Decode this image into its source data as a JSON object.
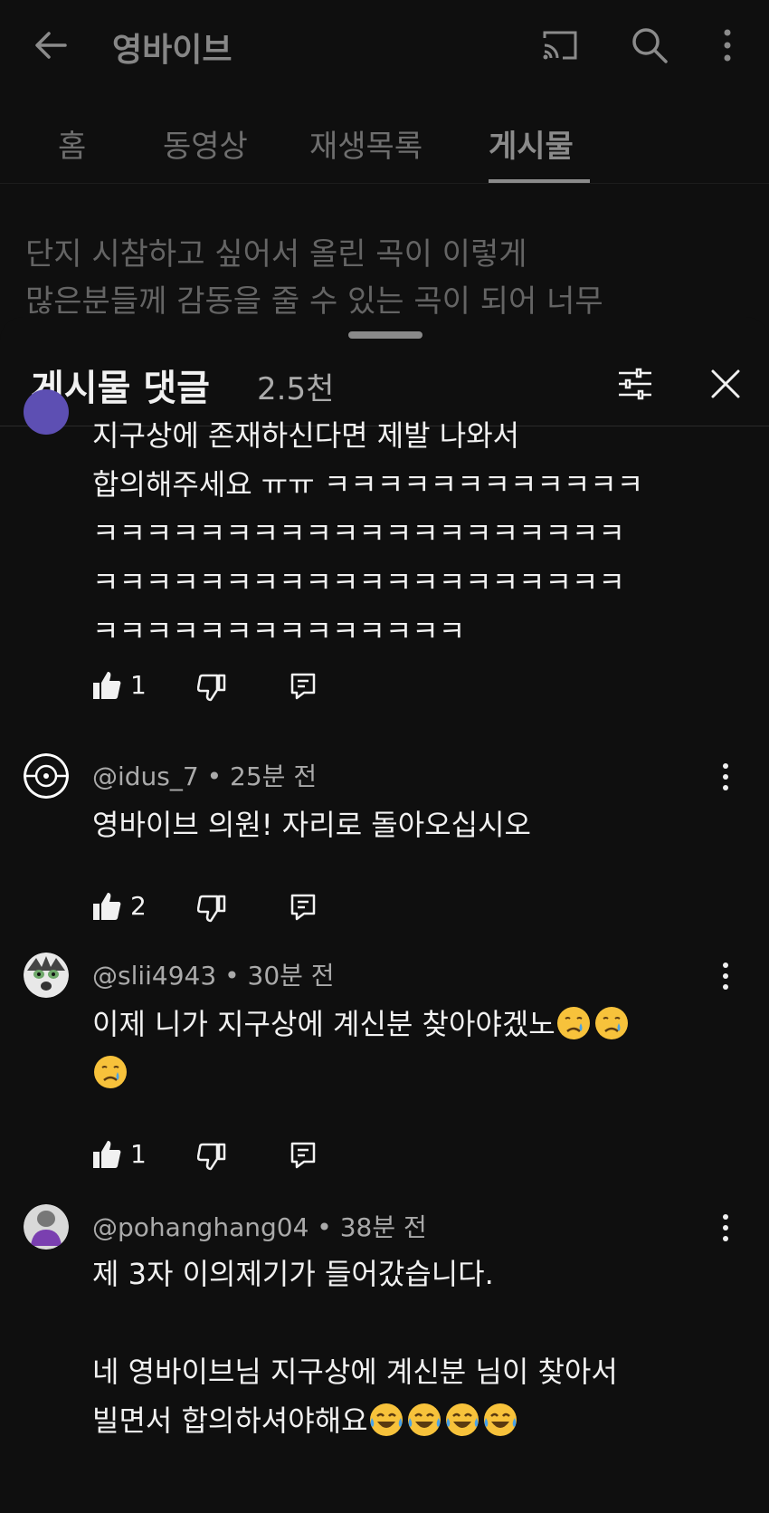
{
  "app": {
    "channel_title": "영바이브",
    "tabs": [
      {
        "label": "홈",
        "active": false
      },
      {
        "label": "동영상",
        "active": false
      },
      {
        "label": "재생목록",
        "active": false
      },
      {
        "label": "게시물",
        "active": true
      }
    ],
    "post_text_line1": "단지 시참하고 싶어서 올린 곡이 이렇게",
    "post_text_line2": "많은분들께 감동을 줄 수 있는 곡이 되어 너무"
  },
  "sheet": {
    "title": "게시물 댓글",
    "count": "2.5천"
  },
  "comments": [
    {
      "author": "",
      "time": "",
      "text": "지구상에 존재하신다면 제발 나와서\n합의해주세요 ㅠㅠ ㅋㅋㅋㅋㅋㅋㅋㅋㅋㅋㅋㅋ\nㅋㅋㅋㅋㅋㅋㅋㅋㅋㅋㅋㅋㅋㅋㅋㅋㅋㅋㅋㅋ\nㅋㅋㅋㅋㅋㅋㅋㅋㅋㅋㅋㅋㅋㅋㅋㅋㅋㅋㅋㅋ\nㅋㅋㅋㅋㅋㅋㅋㅋㅋㅋㅋㅋㅋㅋ",
      "likes": "1"
    },
    {
      "author": "@idus_7",
      "time": "25분 전",
      "text": "영바이브 의원! 자리로 돌아오십시오",
      "likes": "2"
    },
    {
      "author": "@slii4943",
      "time": "30분 전",
      "text_line1": "이제 니가 지구상에 계신분 찾아야겠노",
      "likes": "1",
      "emoji": "crying-face"
    },
    {
      "author": "@pohanghang04",
      "time": "38분 전",
      "text_line1": "제 3자 이의제기가 들어갔습니다.",
      "text_line2": "네 영바이브님 지구상에 계신분 님이 찾아서",
      "text_line3": "빌면서 합의하셔야해요",
      "emoji": "tears-of-joy"
    }
  ],
  "colors": {
    "background": "#0f0f0f",
    "text": "#f1f1f1",
    "secondary": "#aaaaaa"
  }
}
